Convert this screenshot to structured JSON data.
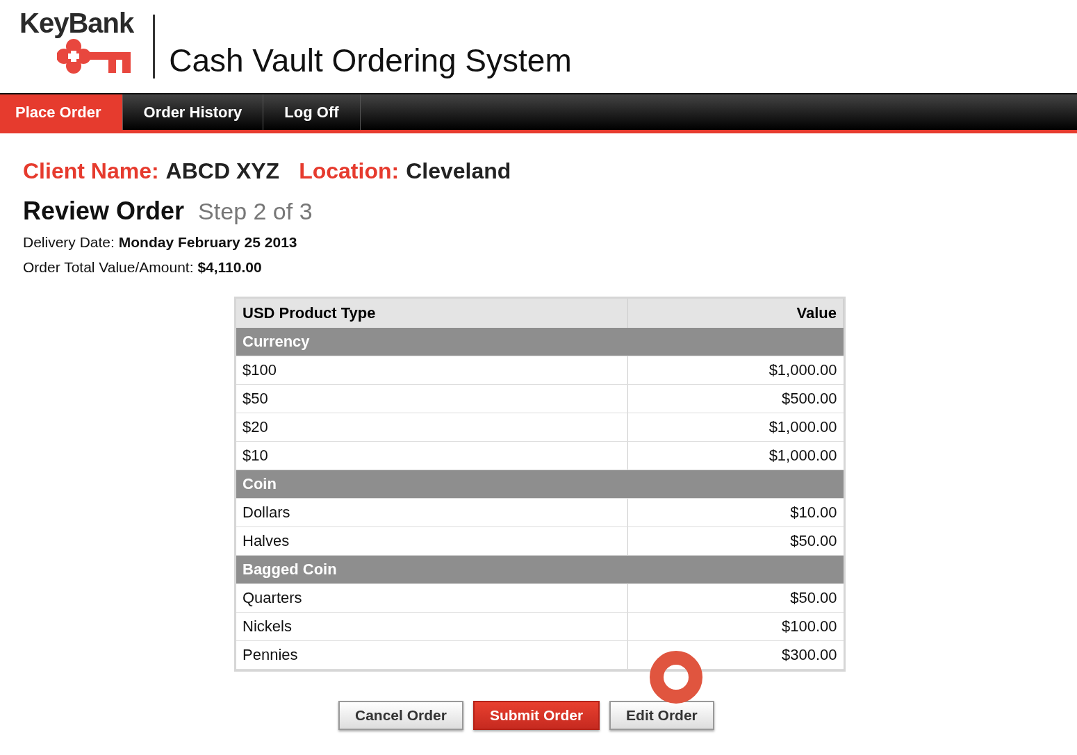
{
  "logo": {
    "brand": "KeyBank"
  },
  "title": "Cash Vault Ordering System",
  "nav": [
    {
      "label": "Place Order",
      "selected": true
    },
    {
      "label": "Order History",
      "selected": false
    },
    {
      "label": "Log Off",
      "selected": false
    }
  ],
  "client": {
    "label": "Client Name:",
    "value": "ABCD XYZ"
  },
  "location": {
    "label": "Location:",
    "value": "Cleveland"
  },
  "heading": "Review Order",
  "step": "Step 2 of 3",
  "details": [
    {
      "label": "Delivery Date:",
      "value": "Monday February 25 2013"
    },
    {
      "label": "Order Total Value/Amount:",
      "value": "$4,110.00"
    }
  ],
  "table": {
    "columns": [
      "USD Product Type",
      "Value"
    ],
    "rows": [
      {
        "kind": "group",
        "label": "Currency"
      },
      {
        "kind": "item",
        "label": "$100",
        "value": "$1,000.00"
      },
      {
        "kind": "item",
        "label": "$50",
        "value": "$500.00"
      },
      {
        "kind": "item",
        "label": "$20",
        "value": "$1,000.00"
      },
      {
        "kind": "item",
        "label": "$10",
        "value": "$1,000.00"
      },
      {
        "kind": "group",
        "label": "Coin"
      },
      {
        "kind": "item",
        "label": "Dollars",
        "value": "$10.00"
      },
      {
        "kind": "item",
        "label": "Halves",
        "value": "$50.00"
      },
      {
        "kind": "group",
        "label": "Bagged Coin"
      },
      {
        "kind": "item",
        "label": "Quarters",
        "value": "$50.00"
      },
      {
        "kind": "item",
        "label": "Nickels",
        "value": "$100.00"
      },
      {
        "kind": "item",
        "label": "Pennies",
        "value": "$300.00"
      }
    ]
  },
  "buttons": [
    {
      "label": "Cancel Order",
      "kind": "default"
    },
    {
      "label": "Submit Order",
      "kind": "primary"
    },
    {
      "label": "Edit Order",
      "kind": "default"
    }
  ]
}
